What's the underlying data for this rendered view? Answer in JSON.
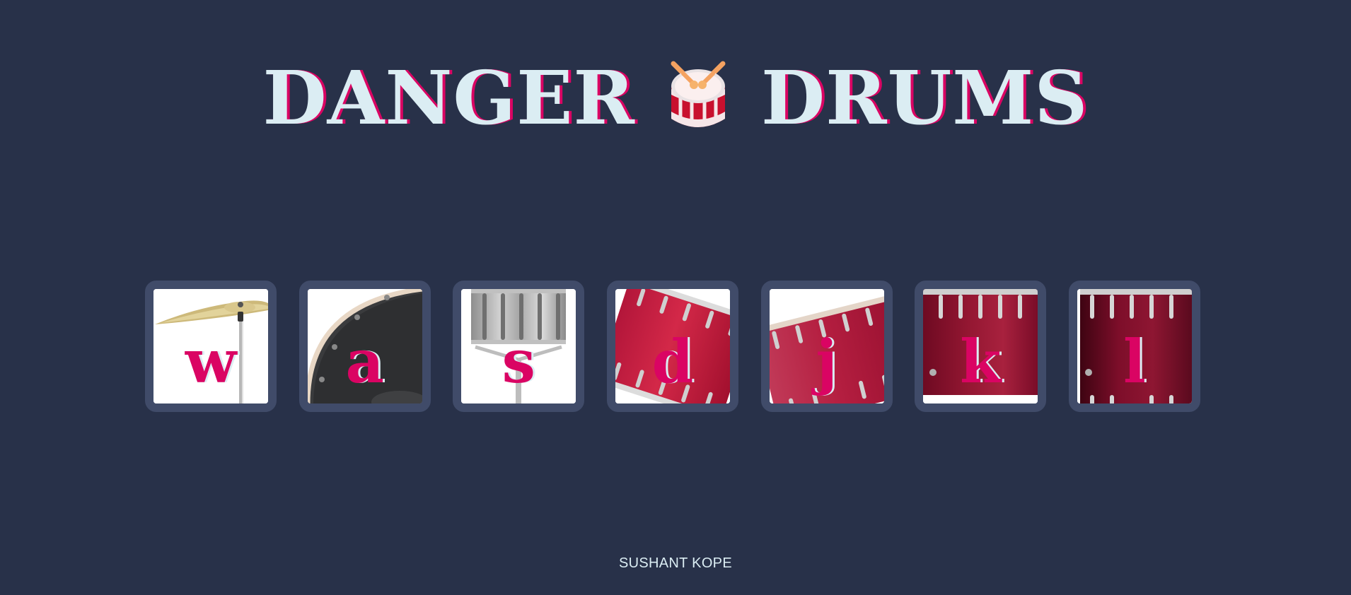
{
  "title": {
    "left_word": "DANGER",
    "right_word": "DRUMS",
    "emoji_icon": "drum-with-drumsticks-icon"
  },
  "drums": [
    {
      "key": "w",
      "icon": "crash-cymbal"
    },
    {
      "key": "a",
      "icon": "kick-drum"
    },
    {
      "key": "s",
      "icon": "snare-drum"
    },
    {
      "key": "d",
      "icon": "tom-1"
    },
    {
      "key": "j",
      "icon": "tom-2"
    },
    {
      "key": "k",
      "icon": "tom-3"
    },
    {
      "key": "l",
      "icon": "tom-4"
    }
  ],
  "footer": {
    "author": "SUSHANT KOPE"
  },
  "colors": {
    "background": "#283149",
    "button_border": "#404B69",
    "accent": "#DA0463",
    "text_light": "#DBEDF3"
  }
}
